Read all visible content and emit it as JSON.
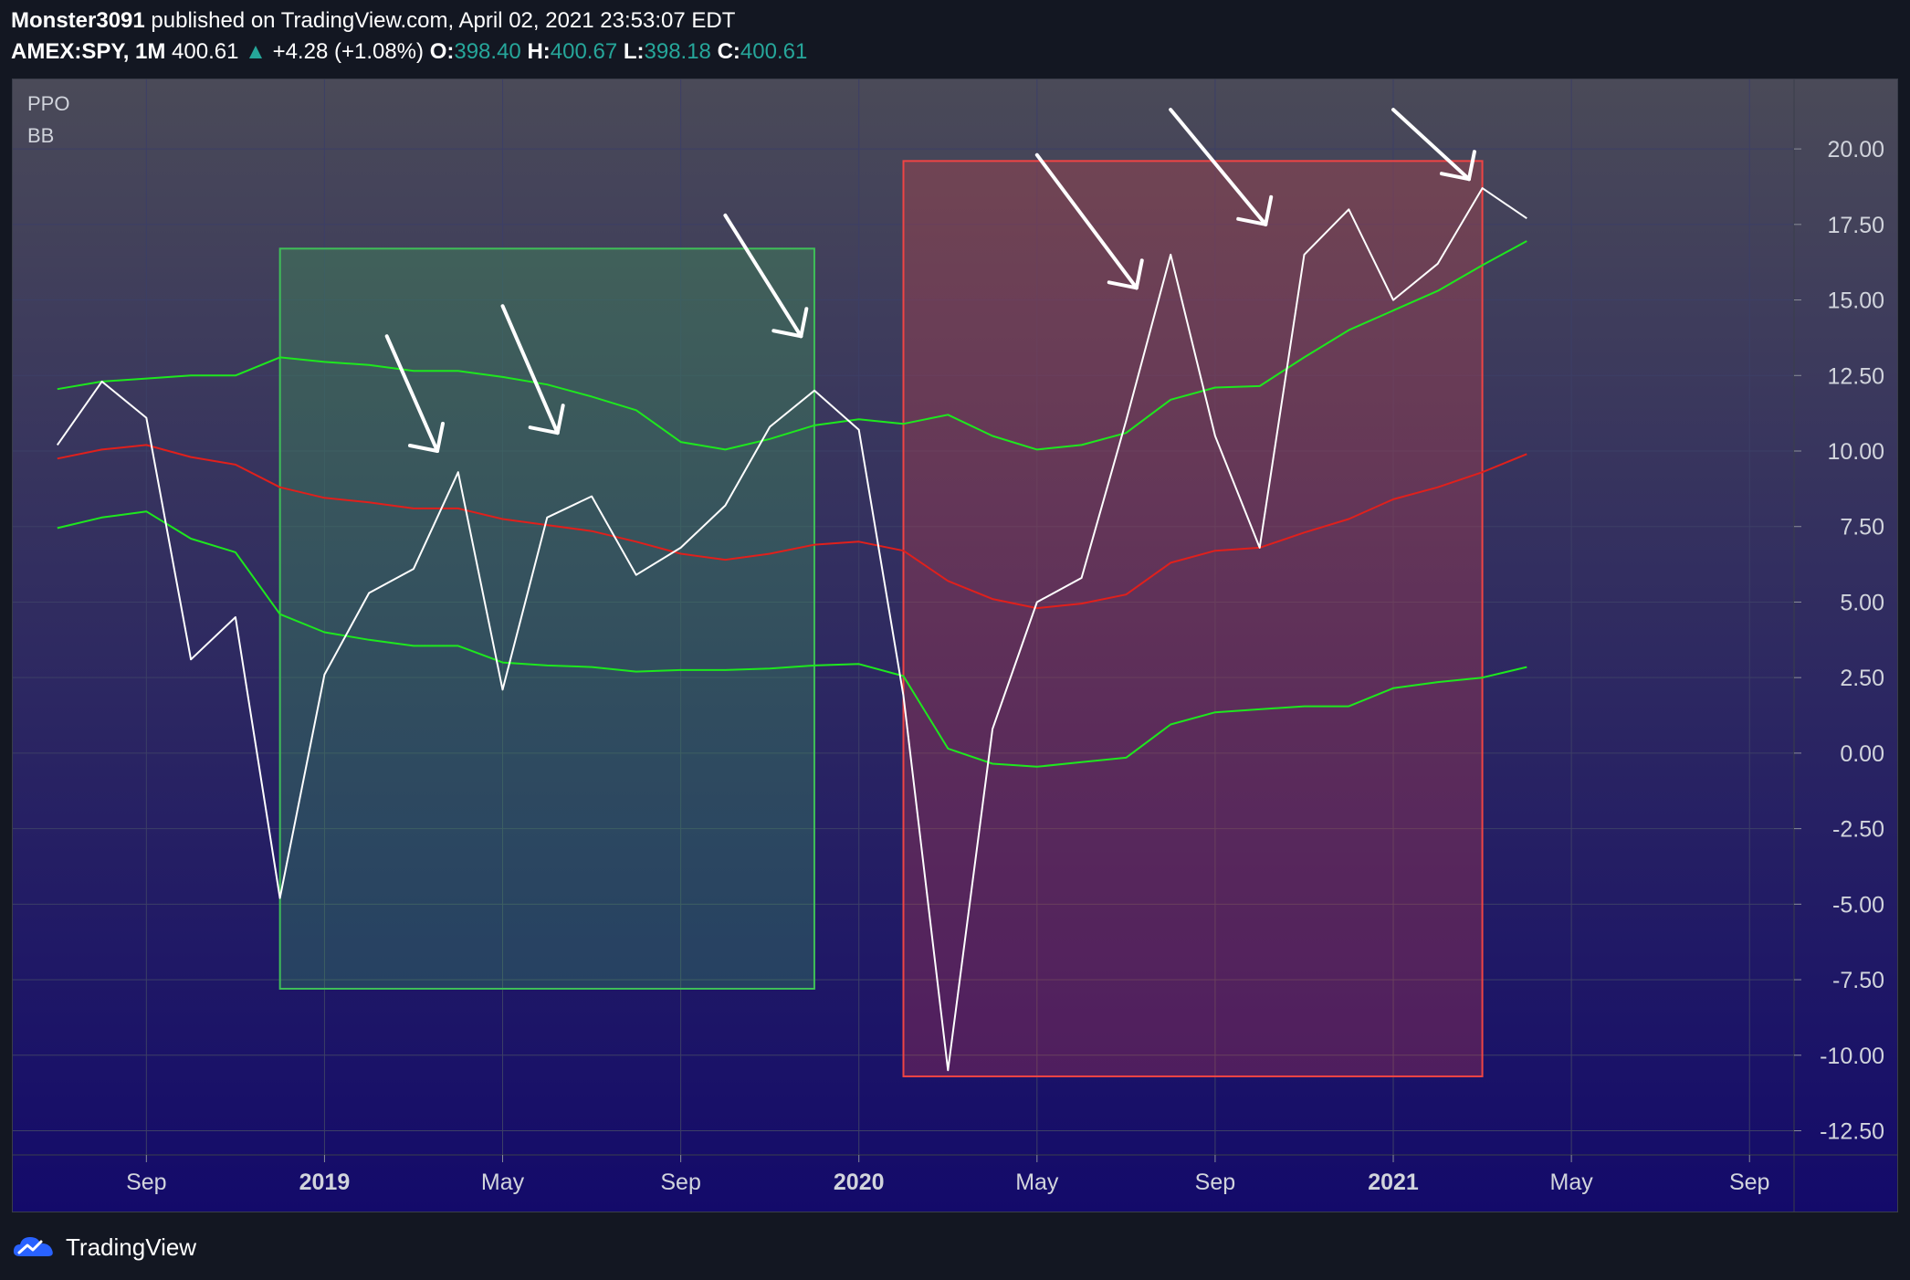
{
  "header": {
    "author": "Monster3091",
    "published": "published on TradingView.com, April 02, 2021 23:53:07 EDT",
    "symbol": "AMEX:SPY, 1M",
    "price": "400.61",
    "change_icon": "triangle-up-icon",
    "change": "+4.28 (+1.08%)",
    "o_label": "O:",
    "o_value": "398.40",
    "h_label": "H:",
    "h_value": "400.67",
    "l_label": "L:",
    "l_value": "398.18",
    "c_label": "C:",
    "c_value": "400.61"
  },
  "indicators": [
    "PPO",
    "BB"
  ],
  "footer": {
    "logo_icon": "tradingview-cloud-icon",
    "brand": "TradingView"
  },
  "colors": {
    "ppo": "#ffffff",
    "bb_basis": "#e0201c",
    "bb_band": "#1ee81e",
    "zone_green": "#3fbf58",
    "zone_red": "#ef4444",
    "arrow": "#ffffff",
    "axis_text": "#d1d4dc",
    "bg_top": "#4a4a58",
    "bg_bottom": "#130a6a",
    "grid": "#3c3f66"
  },
  "chart_data": {
    "type": "line",
    "x_axis": {
      "range": [
        "2018-06",
        "2021-10"
      ],
      "ticks": [
        {
          "date": "2018-09",
          "label": "Sep",
          "bold": false
        },
        {
          "date": "2019-01",
          "label": "2019",
          "bold": true
        },
        {
          "date": "2019-05",
          "label": "May",
          "bold": false
        },
        {
          "date": "2019-09",
          "label": "Sep",
          "bold": false
        },
        {
          "date": "2020-01",
          "label": "2020",
          "bold": true
        },
        {
          "date": "2020-05",
          "label": "May",
          "bold": false
        },
        {
          "date": "2020-09",
          "label": "Sep",
          "bold": false
        },
        {
          "date": "2021-01",
          "label": "2021",
          "bold": true
        },
        {
          "date": "2021-05",
          "label": "May",
          "bold": false
        },
        {
          "date": "2021-09",
          "label": "Sep",
          "bold": false
        }
      ]
    },
    "y_axis": {
      "ylim": [
        -13.3,
        22.3
      ],
      "ticks": [
        "20.00",
        "17.50",
        "15.00",
        "12.50",
        "10.00",
        "7.50",
        "5.00",
        "2.50",
        "0.00",
        "-2.50",
        "-5.00",
        "-7.50",
        "-10.00",
        "-12.50"
      ],
      "tick_values": [
        20,
        17.5,
        15,
        12.5,
        10,
        7.5,
        5,
        2.5,
        0,
        -2.5,
        -5,
        -7.5,
        -10,
        -12.5
      ]
    },
    "grid": true,
    "series": [
      {
        "name": "PPO",
        "role": "ppo",
        "x": [
          "2018-07",
          "2018-08",
          "2018-09",
          "2018-10",
          "2018-11",
          "2018-12",
          "2019-01",
          "2019-02",
          "2019-03",
          "2019-04",
          "2019-05",
          "2019-06",
          "2019-07",
          "2019-08",
          "2019-09",
          "2019-10",
          "2019-11",
          "2019-12",
          "2020-01",
          "2020-02",
          "2020-03",
          "2020-04",
          "2020-05",
          "2020-06",
          "2020-07",
          "2020-08",
          "2020-09",
          "2020-10",
          "2020-11",
          "2020-12",
          "2021-01",
          "2021-02",
          "2021-03",
          "2021-04"
        ],
        "values": [
          10.2,
          12.3,
          11.1,
          3.1,
          4.5,
          -4.8,
          2.6,
          5.3,
          6.1,
          9.3,
          2.1,
          7.8,
          8.5,
          5.9,
          6.8,
          8.2,
          10.8,
          12.0,
          10.7,
          1.9,
          -10.5,
          0.8,
          5.0,
          5.8,
          11.0,
          16.5,
          10.5,
          6.8,
          16.5,
          18.0,
          15.0,
          16.2,
          18.7,
          17.7
        ]
      },
      {
        "name": "BB Upper",
        "role": "bb_band",
        "x": [
          "2018-07",
          "2018-08",
          "2018-09",
          "2018-10",
          "2018-11",
          "2018-12",
          "2019-01",
          "2019-02",
          "2019-03",
          "2019-04",
          "2019-05",
          "2019-06",
          "2019-07",
          "2019-08",
          "2019-09",
          "2019-10",
          "2019-11",
          "2019-12",
          "2020-01",
          "2020-02",
          "2020-03",
          "2020-04",
          "2020-05",
          "2020-06",
          "2020-07",
          "2020-08",
          "2020-09",
          "2020-10",
          "2020-11",
          "2020-12",
          "2021-01",
          "2021-02",
          "2021-03",
          "2021-04"
        ],
        "values": [
          12.05,
          12.3,
          12.4,
          12.5,
          12.5,
          13.1,
          12.95,
          12.85,
          12.65,
          12.65,
          12.45,
          12.2,
          11.8,
          11.35,
          10.3,
          10.05,
          10.4,
          10.85,
          11.05,
          10.9,
          11.2,
          10.5,
          10.05,
          10.2,
          10.6,
          11.7,
          12.1,
          12.15,
          13.1,
          14.0,
          14.65,
          15.3,
          16.15,
          16.95
        ]
      },
      {
        "name": "BB Basis",
        "role": "bb_basis",
        "x": [
          "2018-07",
          "2018-08",
          "2018-09",
          "2018-10",
          "2018-11",
          "2018-12",
          "2019-01",
          "2019-02",
          "2019-03",
          "2019-04",
          "2019-05",
          "2019-06",
          "2019-07",
          "2019-08",
          "2019-09",
          "2019-10",
          "2019-11",
          "2019-12",
          "2020-01",
          "2020-02",
          "2020-03",
          "2020-04",
          "2020-05",
          "2020-06",
          "2020-07",
          "2020-08",
          "2020-09",
          "2020-10",
          "2020-11",
          "2020-12",
          "2021-01",
          "2021-02",
          "2021-03",
          "2021-04"
        ],
        "values": [
          9.75,
          10.05,
          10.2,
          9.8,
          9.55,
          8.8,
          8.45,
          8.3,
          8.1,
          8.1,
          7.75,
          7.55,
          7.35,
          7.0,
          6.6,
          6.4,
          6.6,
          6.9,
          7.0,
          6.7,
          5.7,
          5.1,
          4.8,
          4.95,
          5.25,
          6.3,
          6.7,
          6.8,
          7.3,
          7.75,
          8.4,
          8.8,
          9.3,
          9.9
        ]
      },
      {
        "name": "BB Lower",
        "role": "bb_band",
        "x": [
          "2018-07",
          "2018-08",
          "2018-09",
          "2018-10",
          "2018-11",
          "2018-12",
          "2019-01",
          "2019-02",
          "2019-03",
          "2019-04",
          "2019-05",
          "2019-06",
          "2019-07",
          "2019-08",
          "2019-09",
          "2019-10",
          "2019-11",
          "2019-12",
          "2020-01",
          "2020-02",
          "2020-03",
          "2020-04",
          "2020-05",
          "2020-06",
          "2020-07",
          "2020-08",
          "2020-09",
          "2020-10",
          "2020-11",
          "2020-12",
          "2021-01",
          "2021-02",
          "2021-03",
          "2021-04"
        ],
        "values": [
          7.45,
          7.8,
          8.0,
          7.1,
          6.65,
          4.6,
          4.0,
          3.75,
          3.55,
          3.55,
          3.0,
          2.9,
          2.85,
          2.7,
          2.75,
          2.75,
          2.8,
          2.9,
          2.95,
          2.55,
          0.15,
          -0.35,
          -0.45,
          -0.3,
          -0.15,
          0.95,
          1.35,
          1.45,
          1.55,
          1.55,
          2.15,
          2.35,
          2.5,
          2.85
        ]
      }
    ],
    "zones": [
      {
        "role": "zone_green",
        "x0": "2018-12",
        "x1": "2019-12",
        "y0": -7.8,
        "y1": 16.7
      },
      {
        "role": "zone_red",
        "x0": "2020-02",
        "x1": "2021-03",
        "y0": -10.7,
        "y1": 19.6
      }
    ],
    "annotations": [
      {
        "type": "arrow",
        "from": [
          "2019-02-13",
          13.8
        ],
        "to": [
          "2019-03-17",
          10.0
        ]
      },
      {
        "type": "arrow",
        "from": [
          "2019-05-01",
          14.8
        ],
        "to": [
          "2019-06-08",
          10.6
        ]
      },
      {
        "type": "arrow",
        "from": [
          "2019-10-01",
          17.8
        ],
        "to": [
          "2019-11-22",
          13.8
        ]
      },
      {
        "type": "arrow",
        "from": [
          "2020-05-01",
          19.8
        ],
        "to": [
          "2020-07-08",
          15.4
        ]
      },
      {
        "type": "arrow",
        "from": [
          "2020-08-01",
          21.3
        ],
        "to": [
          "2020-10-05",
          17.5
        ]
      },
      {
        "type": "arrow",
        "from": [
          "2021-01-01",
          21.3
        ],
        "to": [
          "2021-02-22",
          19.0
        ]
      }
    ]
  }
}
